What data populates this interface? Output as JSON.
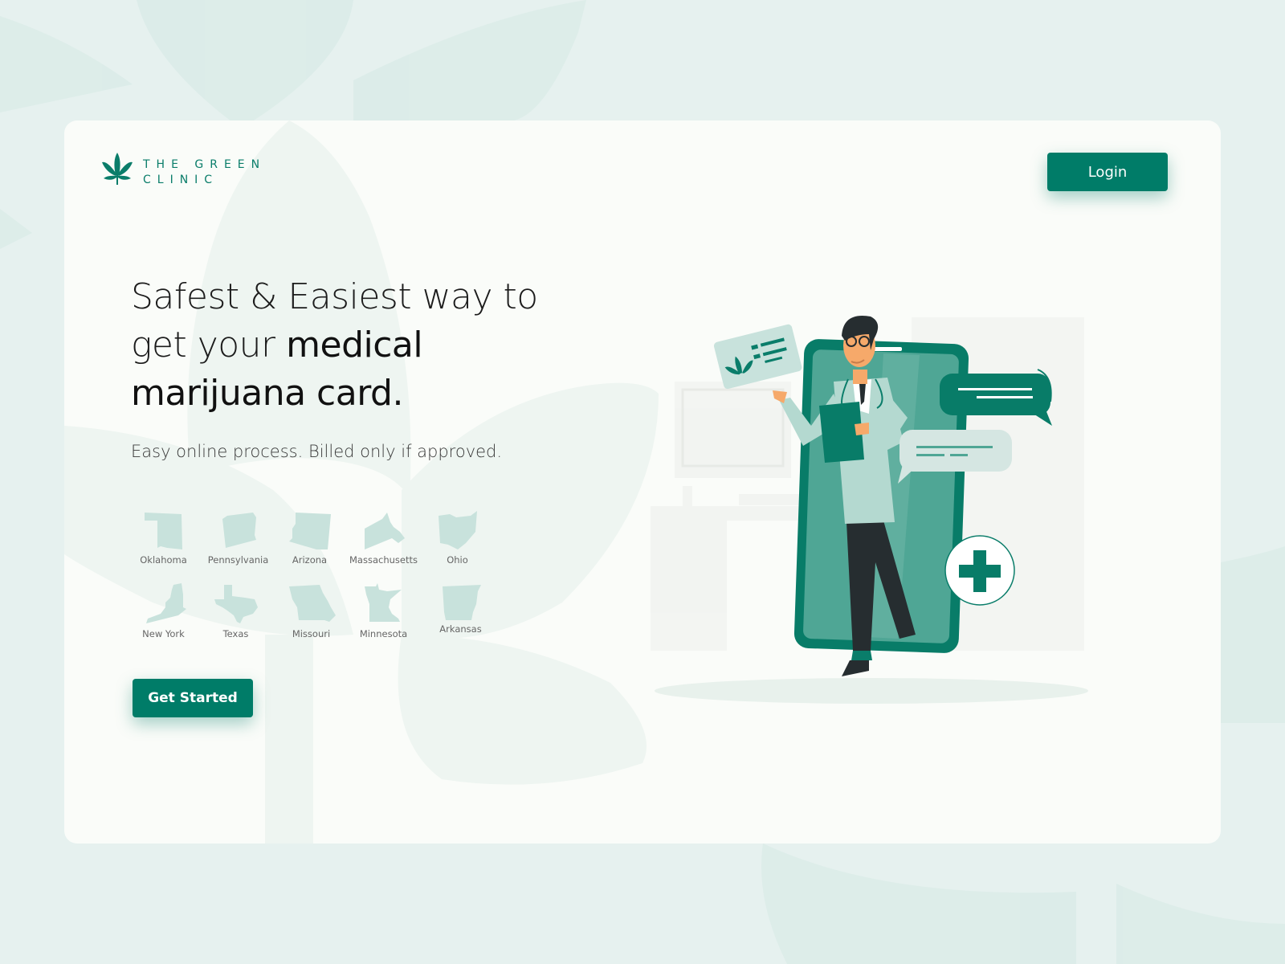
{
  "brand": {
    "line1": "THE GREEN",
    "line2": "CLINIC",
    "icon": "cannabis-leaf-icon",
    "color": "#0a7d6a"
  },
  "header": {
    "login_label": "Login"
  },
  "hero": {
    "headline_pre": "Safest & Easiest way to get your ",
    "headline_bold": "medical marijuana card.",
    "subline": "Easy online process. Billed only if approved."
  },
  "states": [
    {
      "name": "Oklahoma"
    },
    {
      "name": "Pennsylvania"
    },
    {
      "name": "Arizona"
    },
    {
      "name": "Massachusetts"
    },
    {
      "name": "Ohio"
    },
    {
      "name": "New York"
    },
    {
      "name": "Texas"
    },
    {
      "name": "Missouri"
    },
    {
      "name": "Minnesota"
    },
    {
      "name": "Arkansas"
    }
  ],
  "cta": {
    "label": "Get Started"
  },
  "colors": {
    "primary": "#007c68",
    "background": "#e6f1ef",
    "card": "#fafcf9",
    "state_fill": "#c8e2dc"
  }
}
